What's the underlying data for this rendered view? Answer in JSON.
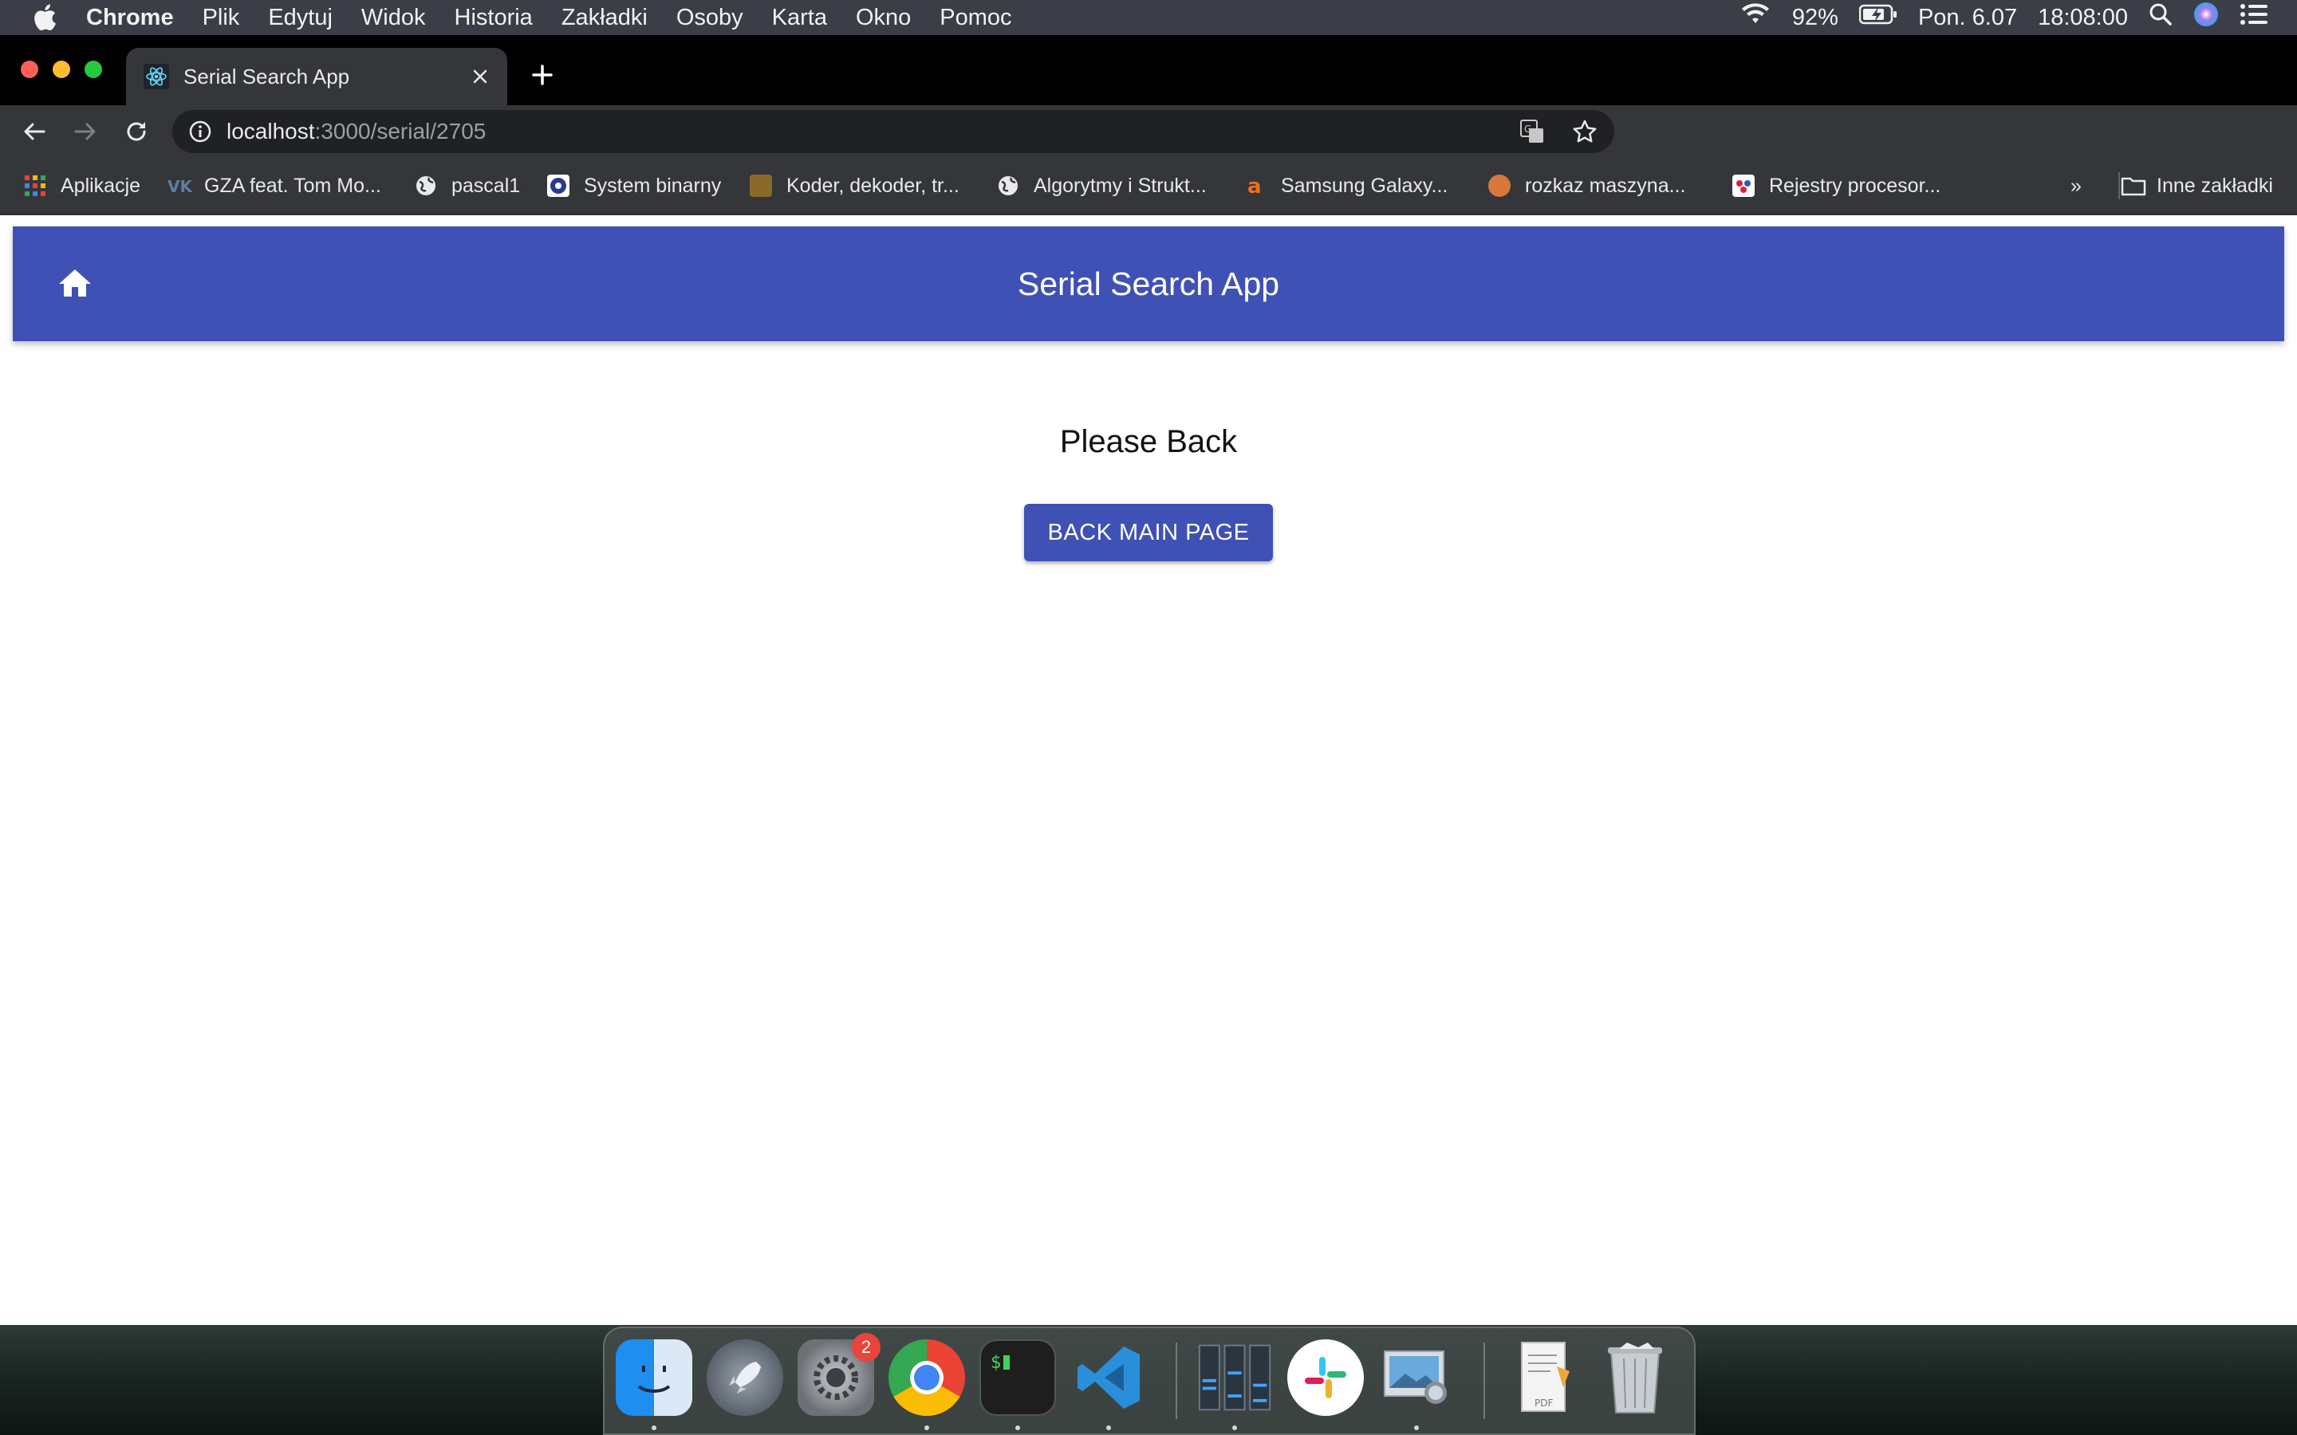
{
  "menubar": {
    "app_name": "Chrome",
    "items": [
      "Plik",
      "Edytuj",
      "Widok",
      "Historia",
      "Zakładki",
      "Osoby",
      "Karta",
      "Okno",
      "Pomoc"
    ],
    "battery": "92%",
    "date": "Pon. 6.07",
    "time": "18:08:00"
  },
  "browser": {
    "tab_title": "Serial Search App",
    "url_host": "localhost",
    "url_path": ":3000/serial/2705",
    "bookmarks": [
      "Aplikacje",
      "GZA feat. Tom Mo...",
      "pascal1",
      "System binarny",
      "Koder, dekoder, tr...",
      "Algorytmy i Strukt...",
      "Samsung Galaxy...",
      "rozkaz maszyna...",
      "Rejestry procesor..."
    ],
    "bookmarks_overflow": "»",
    "other_bookmarks": "Inne zakładki"
  },
  "page": {
    "app_title": "Serial Search App",
    "message": "Please Back",
    "back_button": "BACK MAIN PAGE"
  },
  "dock": {
    "settings_badge": "2"
  }
}
